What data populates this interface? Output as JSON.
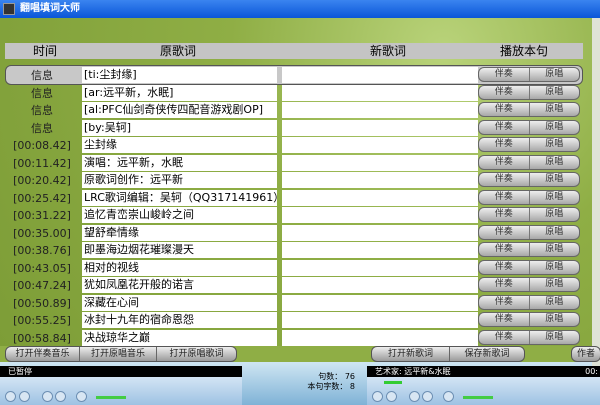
{
  "window": {
    "title": "翻唱填词大师"
  },
  "header": {
    "time": "时间",
    "original": "原歌词",
    "new": "新歌词",
    "play": "播放本句"
  },
  "row_buttons": {
    "accompaniment": "伴奏",
    "original": "原唱"
  },
  "rows": [
    {
      "time": "信息",
      "text": "[ti:尘封缘]"
    },
    {
      "time": "信息",
      "text": "[ar:远平新，水眠]"
    },
    {
      "time": "信息",
      "text": "[al:PFC仙剑奇侠传四配音游戏剧OP]"
    },
    {
      "time": "信息",
      "text": "[by:吴轲]"
    },
    {
      "time": "[00:08.42]",
      "text": "尘封缘"
    },
    {
      "time": "[00:11.42]",
      "text": "演唱：远平新，水眠"
    },
    {
      "time": "[00:20.42]",
      "text": "原歌词创作：远平新"
    },
    {
      "time": "[00:25.42]",
      "text": "LRC歌词编辑：吴轲（QQ317141961）"
    },
    {
      "time": "[00:31.22]",
      "text": "追忆青峦崇山峻岭之间"
    },
    {
      "time": "[00:35.00]",
      "text": "望舒牵情缘"
    },
    {
      "time": "[00:38.76]",
      "text": "即墨海边烟花璀璨漫天"
    },
    {
      "time": "[00:43.05]",
      "text": "相对的视线"
    },
    {
      "time": "[00:47.24]",
      "text": "犹如凤凰花开般的诺言"
    },
    {
      "time": "[00:50.89]",
      "text": "深藏在心间"
    },
    {
      "time": "[00:55.25]",
      "text": "冰封十九年的宿命恩怨"
    },
    {
      "time": "[00:58.84]",
      "text": "决战琼华之巅"
    }
  ],
  "toolbar_left": [
    "打开伴奏音乐",
    "打开原唱音乐",
    "打开原唱歌词"
  ],
  "toolbar_right": [
    "打开新歌词",
    "保存新歌词"
  ],
  "author_button": "作者",
  "left_player": {
    "status": "已暂停"
  },
  "right_player": {
    "status": "艺术家: 远平新&水眠",
    "time": "00:"
  },
  "stats": {
    "lines_label": "句数：",
    "lines_value": "76",
    "chars_label": "本句字数：",
    "chars_value": "8"
  }
}
